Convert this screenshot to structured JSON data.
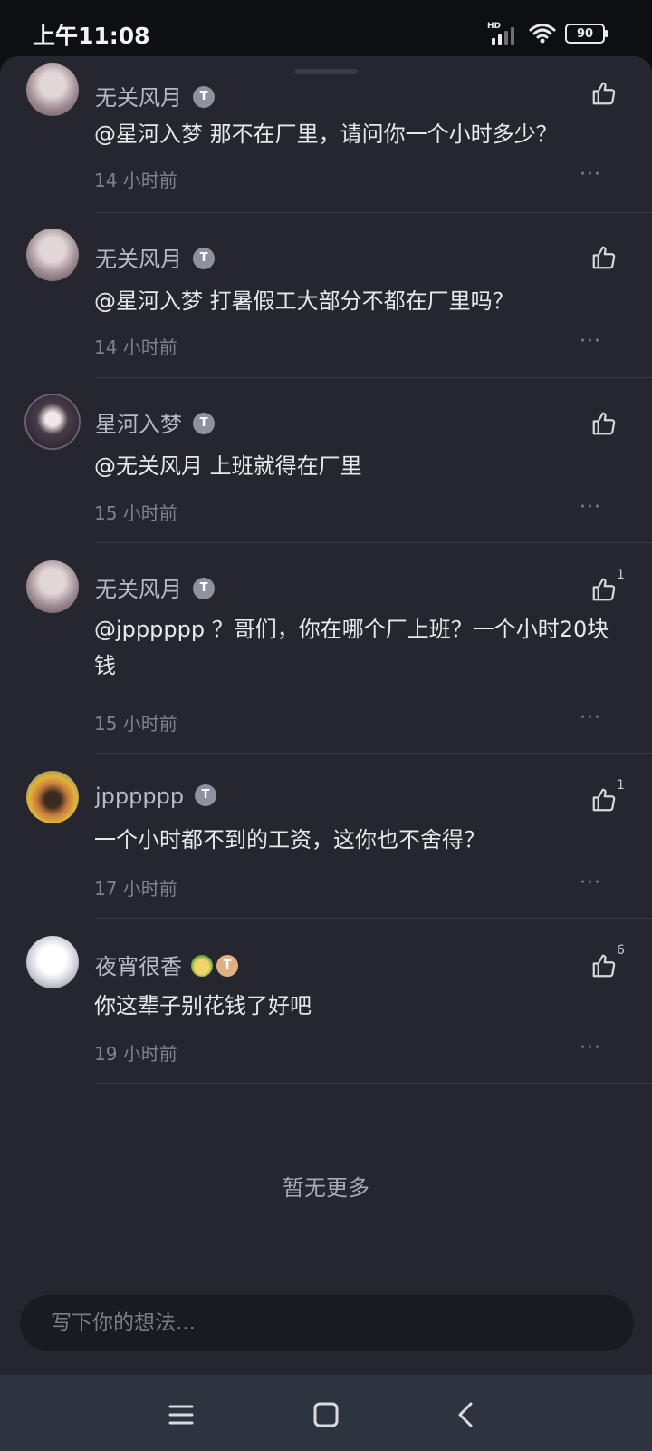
{
  "status_bar": {
    "time": "上午11:08",
    "network": "HD",
    "battery": "90"
  },
  "comments": [
    {
      "name": "无关风月",
      "badge": "T",
      "text": "@星河入梦  那不在厂里，请问你一个小时多少？",
      "time": "14 小时前",
      "likes": ""
    },
    {
      "name": "无关风月",
      "badge": "T",
      "text": "@星河入梦  打暑假工大部分不都在厂里吗？",
      "time": "14 小时前",
      "likes": ""
    },
    {
      "name": "星河入梦",
      "badge": "T",
      "text": "@无关风月  上班就得在厂里",
      "time": "15 小时前",
      "likes": ""
    },
    {
      "name": "无关风月",
      "badge": "T",
      "text": "@jpppppp  ？哥们，你在哪个厂上班？一个小时20块钱",
      "time": "15 小时前",
      "likes": "1"
    },
    {
      "name": "jpppppp",
      "badge": "T",
      "text": "一个小时都不到的工资，这你也不舍得？",
      "time": "17 小时前",
      "likes": "1"
    },
    {
      "name": "夜宵很香",
      "badge": "T",
      "text": "你这辈子别花钱了好吧",
      "time": "19 小时前",
      "likes": "6"
    }
  ],
  "more_label": "···",
  "end_text": "暂无更多",
  "input": {
    "placeholder": "写下你的想法...",
    "value": ""
  },
  "icons": {
    "like": "thumbs-up-icon",
    "more": "more-dots-icon",
    "nav": [
      "menu-icon",
      "home-icon",
      "back-icon"
    ]
  }
}
